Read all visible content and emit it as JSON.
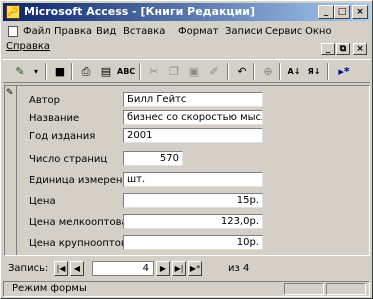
{
  "window": {
    "title": "Microsoft Access - [Книги Редакции]",
    "app_icon": "key-icon"
  },
  "title_buttons": {
    "minimize": "_",
    "maximize": "□",
    "close": "×"
  },
  "menu": {
    "items": [
      "Файл",
      "Правка",
      "Вид",
      "Вставка",
      "Формат",
      "Записи",
      "Сервис",
      "Окно",
      "Справка"
    ],
    "mdi_buttons": {
      "minimize": "_",
      "restore": "⧉",
      "close": "×"
    }
  },
  "toolbar": {
    "tools": [
      "design-view-icon",
      "save-icon",
      "print-icon",
      "print-preview-icon",
      "spelling-icon",
      "cut-icon",
      "copy-icon",
      "paste-icon",
      "format-painter-icon",
      "undo-icon",
      "hyperlink-icon",
      "sort-ascending-icon",
      "sort-descending-icon",
      "new-record-icon"
    ]
  },
  "form": {
    "fields": [
      {
        "label": "Автор",
        "value": "Билл Гейтс"
      },
      {
        "label": "Название",
        "value": "бизнес со скоростью мысли"
      },
      {
        "label": "Год издания",
        "value": "2001"
      },
      {
        "label": "Число страниц",
        "value": "570"
      },
      {
        "label": "Единица измерения",
        "value": "шт."
      },
      {
        "label": "Цена",
        "value": "15р."
      },
      {
        "label": "Цена мелкооптовая",
        "value": "123,0р."
      },
      {
        "label": "Цена крупнооптовая",
        "value": "10р."
      }
    ]
  },
  "navigation": {
    "label": "Запись:",
    "current": "4",
    "of_label": "из",
    "total": "4",
    "buttons": {
      "first": "|◀",
      "prev": "◀",
      "next": "▶",
      "last": "▶|",
      "new": "▶*"
    }
  },
  "status": {
    "text": "Режим формы"
  }
}
